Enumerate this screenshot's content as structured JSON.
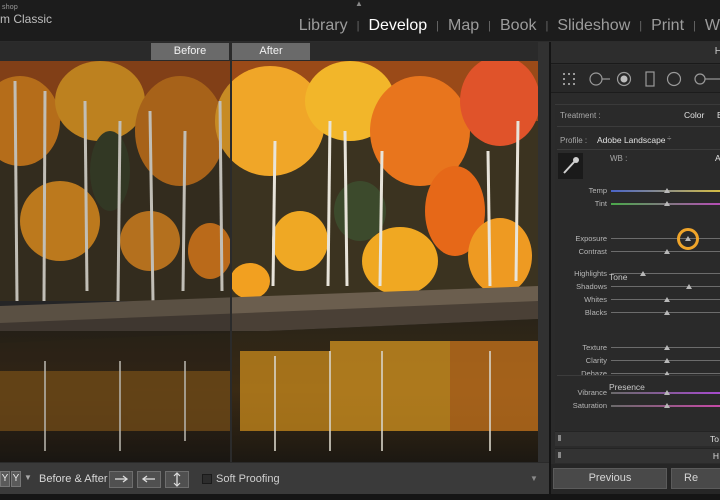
{
  "app": {
    "brand_small": "shop",
    "brand_big": "m Classic"
  },
  "modules": [
    "Library",
    "Develop",
    "Map",
    "Book",
    "Slideshow",
    "Print",
    "W"
  ],
  "active_module": "Develop",
  "viewer": {
    "before_label": "Before",
    "after_label": "After"
  },
  "toolbar": {
    "yy_left": "Y",
    "yy_right": "Y",
    "before_after_label": "Before & After :",
    "soft_proofing_label": "Soft Proofing",
    "soft_proofing_checked": false
  },
  "panel": {
    "header_letter": "H",
    "treatment_label": "Treatment :",
    "treatment_value": "Color",
    "treatment_value2": "B",
    "profile_label": "Profile :",
    "profile_value": "Adobe Landscape",
    "wb_label": "WB :",
    "wb_value": "A",
    "tone_label": "Tone",
    "presence_label": "Presence",
    "sliders": {
      "temp": {
        "label": "Temp",
        "value": 0.5
      },
      "tint": {
        "label": "Tint",
        "value": 0.5
      },
      "exposure": {
        "label": "Exposure",
        "value": 0.69
      },
      "contrast": {
        "label": "Contrast",
        "value": 0.5
      },
      "highlights": {
        "label": "Highlights",
        "value": 0.29
      },
      "shadows": {
        "label": "Shadows",
        "value": 0.7
      },
      "whites": {
        "label": "Whites",
        "value": 0.5
      },
      "blacks": {
        "label": "Blacks",
        "value": 0.5
      },
      "texture": {
        "label": "Texture",
        "value": 0.5
      },
      "clarity": {
        "label": "Clarity",
        "value": 0.5
      },
      "dehaze": {
        "label": "Dehaze",
        "value": 0.5
      },
      "vibrance": {
        "label": "Vibrance",
        "value": 0.5
      },
      "saturation": {
        "label": "Saturation",
        "value": 0.5
      }
    },
    "collapsed_1": "To",
    "collapsed_2": "H",
    "previous_label": "Previous",
    "reset_label": "Re"
  },
  "colors": {
    "accent_ring": "#f0a52a",
    "autumn_orange": "#e8891a",
    "autumn_yellow": "#f0b422"
  }
}
